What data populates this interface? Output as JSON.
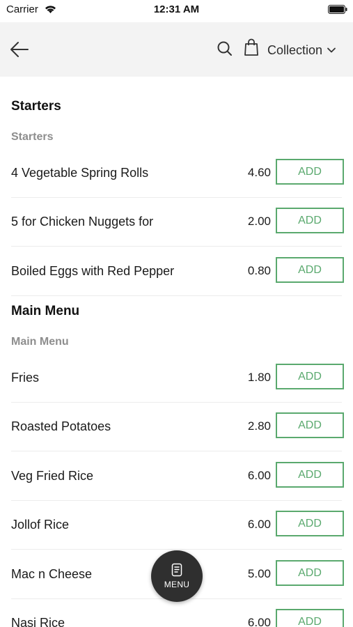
{
  "status": {
    "carrier": "Carrier",
    "time": "12:31 AM"
  },
  "header": {
    "collection_label": "Collection"
  },
  "sections": [
    {
      "title": "Starters",
      "subtitle": "Starters",
      "items": [
        {
          "name": "4 Vegetable Spring Rolls",
          "price": "4.60",
          "add_label": "ADD"
        },
        {
          "name": "5 for Chicken Nuggets for",
          "price": "2.00",
          "add_label": "ADD"
        },
        {
          "name": "Boiled Eggs with Red Pepper",
          "price": "0.80",
          "add_label": "ADD"
        }
      ]
    },
    {
      "title": "Main Menu",
      "subtitle": "Main Menu",
      "items": [
        {
          "name": "Fries",
          "price": "1.80",
          "add_label": "ADD"
        },
        {
          "name": "Roasted Potatoes",
          "price": "2.80",
          "add_label": "ADD"
        },
        {
          "name": "Veg Fried Rice",
          "price": "6.00",
          "add_label": "ADD"
        },
        {
          "name": "Jollof Rice",
          "price": "6.00",
          "add_label": "ADD"
        },
        {
          "name": "Mac n Cheese",
          "price": "5.00",
          "add_label": "ADD"
        },
        {
          "name": "Nasi Rice",
          "price": "6.00",
          "add_label": "ADD"
        }
      ]
    }
  ],
  "fab": {
    "label": "MENU"
  },
  "colors": {
    "accent": "#5aa96e",
    "header_bg": "#f3f3f3",
    "fab_bg": "#2f2f2f",
    "subtitle": "#8e8e8e"
  }
}
